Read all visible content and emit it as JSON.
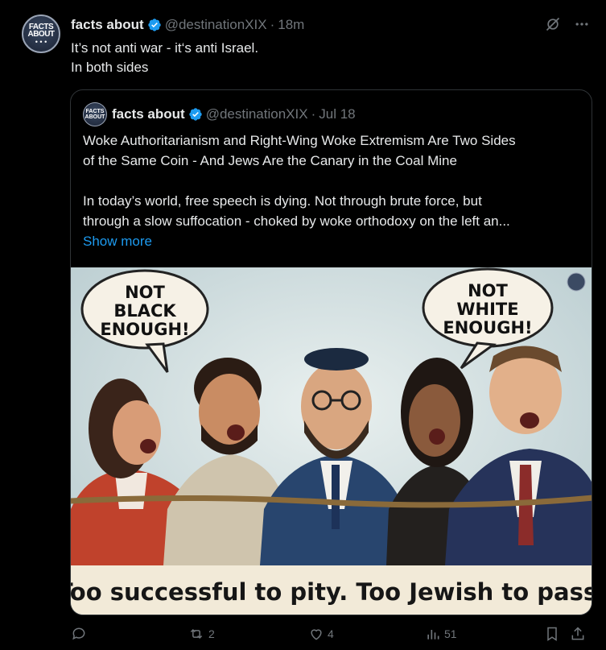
{
  "tweet": {
    "avatar_text_line1": "FACTS",
    "avatar_text_line2": "ABOUT",
    "author_name": "facts about",
    "handle": "@destinationXIX",
    "separator": "·",
    "time": "18m",
    "text_line1": "It’s not anti war - it‘s anti Israel.",
    "text_line2": "In both sides"
  },
  "quote": {
    "author_name": "facts about",
    "handle": "@destinationXIX",
    "separator": "·",
    "date": "Jul 18",
    "headline_line1": "Woke Authoritarianism and Right-Wing Woke Extremism Are Two Sides",
    "headline_line2": "of the Same Coin - And Jews Are the Canary in the Coal Mine",
    "body_line1": "In today’s world, free speech is dying. Not through brute force, but",
    "body_line2": "through a slow suffocation - choked by woke orthodoxy on the left an...",
    "show_more": "Show more",
    "image": {
      "bubble_left": [
        "NOT",
        "BLACK",
        "ENOUGH!"
      ],
      "bubble_right": [
        "NOT",
        "WHITE",
        "ENOUGH!"
      ],
      "caption": "Too successful to pity. Too Jewish to pass."
    }
  },
  "actions": {
    "reply_count": "",
    "repost_count": "2",
    "like_count": "4",
    "views_count": "51"
  },
  "colors": {
    "background": "#000000",
    "text": "#e7e9ea",
    "muted": "#71767b",
    "accent": "#1d9bf0",
    "border": "#2f3336"
  }
}
